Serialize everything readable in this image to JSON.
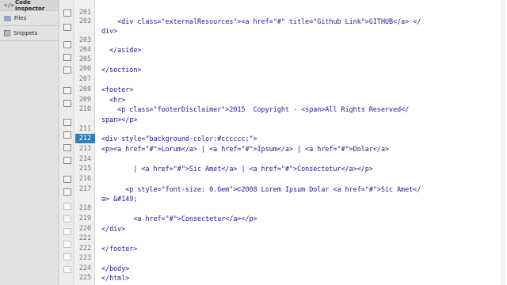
{
  "panel": {
    "title": "Code Inspector",
    "items": [
      "Files",
      "Snippets"
    ]
  },
  "gutter": {
    "line_numbers": [
      "201",
      "202",
      "203",
      "204",
      "205",
      "206",
      "207",
      "208",
      "209",
      "210",
      "",
      "211",
      "212",
      "213",
      "214",
      "215",
      "216",
      "217",
      "218",
      "219",
      "220",
      "221",
      "222",
      "223",
      "224",
      "225"
    ],
    "active_line": "212"
  },
  "editor": {
    "lines": [
      "",
      "    <div class=\"externalResources\"><a href=\"#\" title=\"Github Link\">GITHUB</a> </",
      "div>",
      "",
      "  </aside>",
      "",
      "</section>",
      "",
      "<footer>",
      "  <hr>",
      "    <p class=\"footerDisclaimer\">2015  Copyright - <span>All Rights Reserved</",
      "span></p>",
      "",
      "<div style=\"background-color:#cccccc;\">",
      "<p><a href=\"#\">Lorum</a> | <a href=\"#\">Ipsum</a> | <a href=\"#\">Dolar</a>",
      "",
      "        | <a href=\"#\">Sic Amet</a> | <a href=\"#\">Consectetur</a></p>",
      "",
      "      <p style=\"font-size: 0.6em\">©2008 Lorem Ipsum Dolar <a href=\"#\">Sic Amet</",
      "a> &#149;",
      "",
      "        <a href=\"#\">Consectetur</a></p>",
      "</div>",
      "",
      "</footer>",
      "",
      "</body>",
      "</html>"
    ]
  }
}
